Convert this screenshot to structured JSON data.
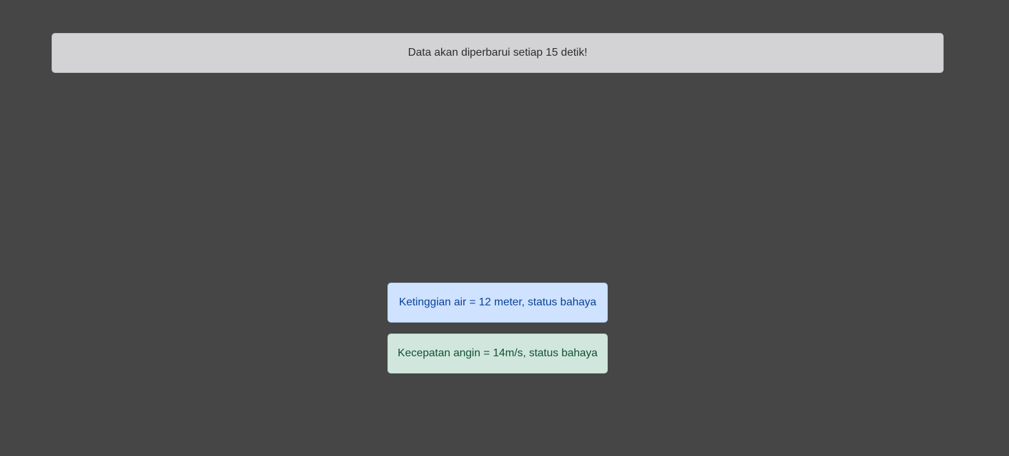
{
  "notice": {
    "text": "Data akan diperbarui setiap 15 detik!"
  },
  "alerts": [
    {
      "text": "Ketinggian air = 12 meter, status bahaya",
      "color": "#084298",
      "background": "#cfe2ff"
    },
    {
      "text": "Kecepatan angin = 14m/s, status bahaya",
      "color": "#0f5132",
      "background": "#d1e7dd"
    }
  ]
}
